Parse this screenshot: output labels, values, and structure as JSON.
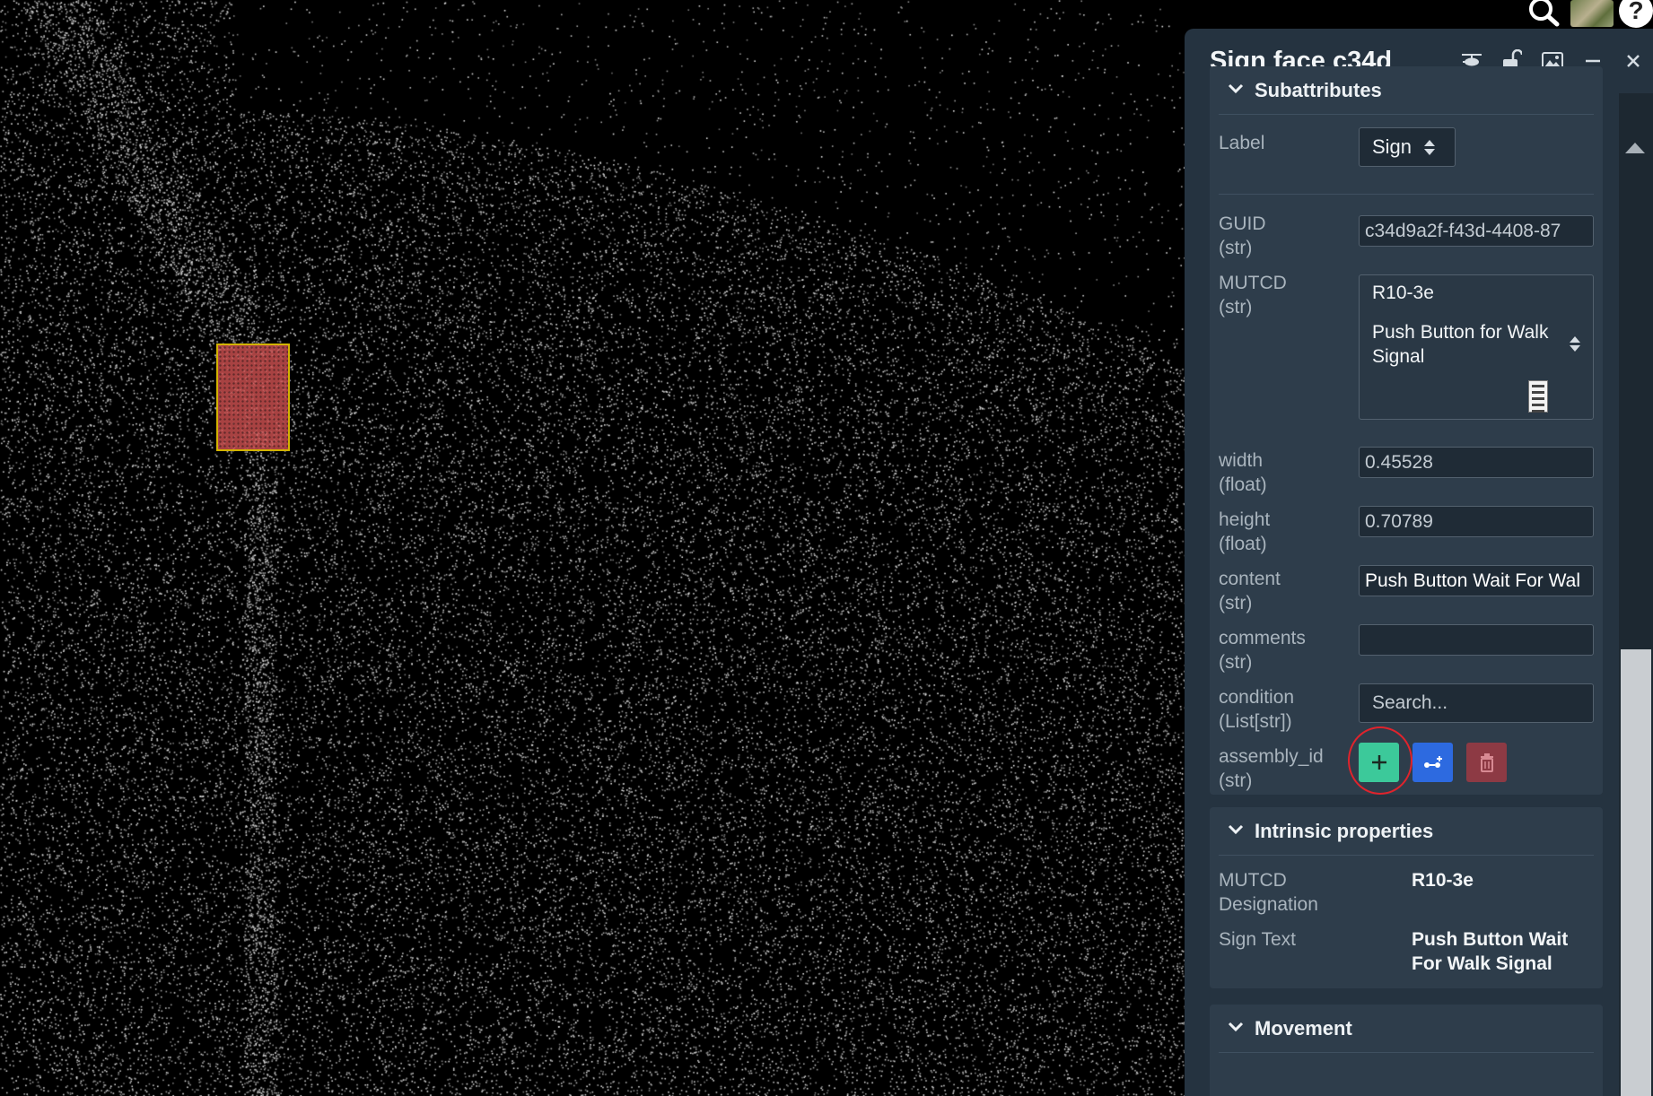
{
  "panel": {
    "title": "Sign face c34d",
    "header_icons": [
      "helicopter-icon",
      "unlock-icon",
      "image-icon",
      "minimize-icon",
      "close-icon"
    ]
  },
  "subattributes": {
    "title": "Subattributes",
    "label": {
      "name": "Label",
      "value": "Sign"
    },
    "guid": {
      "name": "GUID",
      "type": "(str)",
      "value": "c34d9a2f-f43d-4408-87"
    },
    "mutcd": {
      "name": "MUTCD",
      "type": "(str)",
      "code": "R10-3e",
      "description": "Push Button for Walk Signal"
    },
    "width": {
      "name": "width",
      "type": "(float)",
      "value": "0.45528"
    },
    "height": {
      "name": "height",
      "type": "(float)",
      "value": "0.70789"
    },
    "content": {
      "name": "content",
      "type": "(str)",
      "value": "Push Button Wait For Wal"
    },
    "comments": {
      "name": "comments",
      "type": "(str)",
      "value": ""
    },
    "condition": {
      "name": "condition",
      "type": "(List[str])",
      "placeholder": "Search..."
    },
    "assembly_id": {
      "name": "assembly_id",
      "type": "(str)"
    }
  },
  "intrinsic": {
    "title": "Intrinsic properties",
    "mutcd_label_1": "MUTCD",
    "mutcd_label_2": "Designation",
    "mutcd_value": "R10-3e",
    "sign_text_label": "Sign Text",
    "sign_text_value_1": "Push Button Wait",
    "sign_text_value_2": "For Walk Signal"
  },
  "movement": {
    "title": "Movement"
  },
  "colors": {
    "panel_bg": "#253340",
    "card_bg": "#2e3d4b",
    "add_button": "#3cc99a",
    "link_button": "#2d6ae0",
    "delete_button": "#8d3a44",
    "highlight": "#e0232c",
    "selection_fill": "#cd5050",
    "selection_border": "#d2b300"
  }
}
